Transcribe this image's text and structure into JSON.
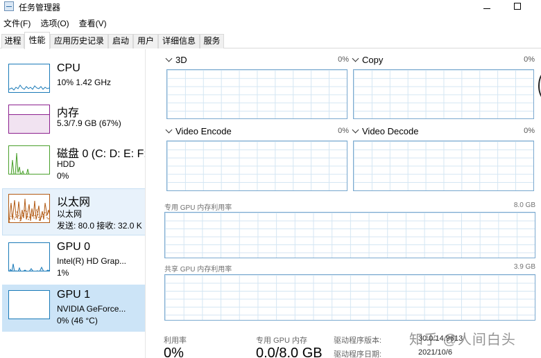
{
  "window": {
    "title": "任务管理器"
  },
  "menu": {
    "file": "文件(F)",
    "options": "选项(O)",
    "view": "查看(V)"
  },
  "tabs": [
    "进程",
    "性能",
    "应用历史记录",
    "启动",
    "用户",
    "详细信息",
    "服务"
  ],
  "sidebar": {
    "cpu": {
      "title": "CPU",
      "sub1": "10% 1.42 GHz",
      "sub2": "",
      "color": "#1a7ab8"
    },
    "memory": {
      "title": "内存",
      "sub1": "5.3/7.9 GB (67%)",
      "sub2": "",
      "color": "#8b1f8e"
    },
    "disk": {
      "title": "磁盘 0 (C: D: E: F:",
      "sub1": "HDD",
      "sub2": "0%",
      "color": "#4aa02c"
    },
    "ethernet": {
      "title": "以太网",
      "sub1": "以太网",
      "sub2": "发送: 80.0 接收: 32.0 K",
      "color": "#b25a14"
    },
    "gpu0": {
      "title": "GPU 0",
      "sub1": "Intel(R) HD Grap...",
      "sub2": "1%",
      "color": "#1a7ab8"
    },
    "gpu1": {
      "title": "GPU 1",
      "sub1": "NVIDIA GeForce...",
      "sub2": "0% (46 °C)",
      "color": "#1a7ab8"
    }
  },
  "engines": [
    {
      "name": "3D",
      "pct": "0%"
    },
    {
      "name": "Copy",
      "pct": "0%"
    },
    {
      "name": "Video Encode",
      "pct": "0%"
    },
    {
      "name": "Video Decode",
      "pct": "0%"
    }
  ],
  "dedicated": {
    "label": "专用 GPU 内存利用率",
    "max": "8.0 GB"
  },
  "shared": {
    "label": "共享 GPU 内存利用率",
    "max": "3.9 GB"
  },
  "stats": {
    "util_label": "利用率",
    "util_value": "0%",
    "dedmem_label": "专用 GPU 内存",
    "dedmem_value": "0.0/8.0 GB"
  },
  "driver": {
    "version_label": "驱动程序版本:",
    "version_value": "30.0.14.9613",
    "date_label": "驱动程序日期:",
    "date_value": "2021/10/6"
  },
  "watermark": "知乎 @人间白头",
  "graph_border": "#7ba9cf",
  "graph_grid": "#d4e6f3"
}
